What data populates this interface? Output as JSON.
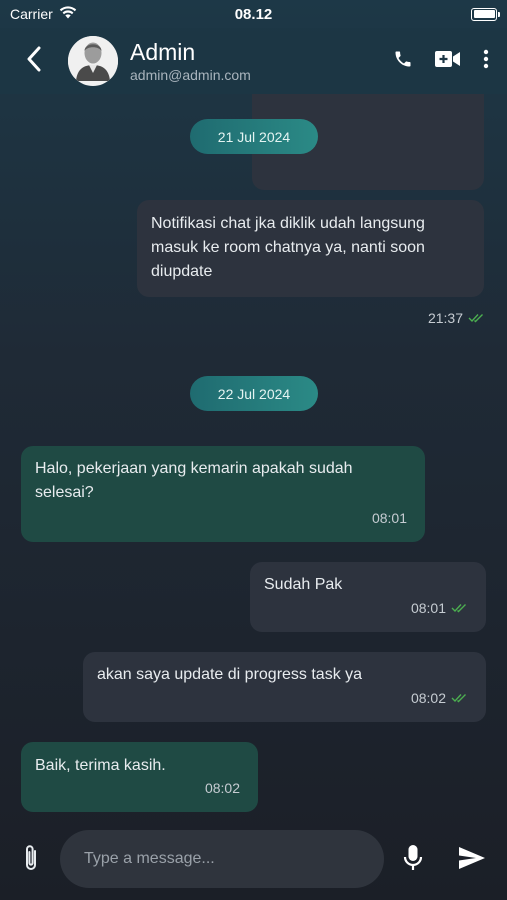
{
  "status_bar": {
    "carrier": "Carrier",
    "time": "08.12"
  },
  "header": {
    "name": "Admin",
    "email": "admin@admin.com"
  },
  "dates": [
    "21 Jul 2024",
    "22 Jul 2024"
  ],
  "messages": [
    {
      "direction": "out",
      "text": "Notifikasi chat jka diklik udah langsung masuk ke room chatnya ya, nanti soon diupdate",
      "time": "21:37",
      "read": true
    },
    {
      "direction": "in",
      "text": "Halo, pekerjaan yang kemarin apakah sudah selesai?",
      "time": "08:01"
    },
    {
      "direction": "out",
      "text": "Sudah Pak",
      "time": "08:01",
      "read": true
    },
    {
      "direction": "out",
      "text": "akan saya update di progress task ya",
      "time": "08:02",
      "read": true
    },
    {
      "direction": "in",
      "text": "Baik, terima kasih.",
      "time": "08:02"
    }
  ],
  "input": {
    "placeholder": "Type a message..."
  },
  "colors": {
    "read_tick": "#4caf50",
    "incoming_bubble": "#1f4a44",
    "outgoing_bubble": "#2d333e",
    "date_chip": "#268079"
  },
  "icons": [
    "wifi-icon",
    "battery-icon",
    "back-arrow-icon",
    "avatar-icon",
    "phone-icon",
    "video-call-icon",
    "more-vertical-icon",
    "double-check-icon",
    "attach-icon",
    "mic-icon",
    "send-icon"
  ]
}
